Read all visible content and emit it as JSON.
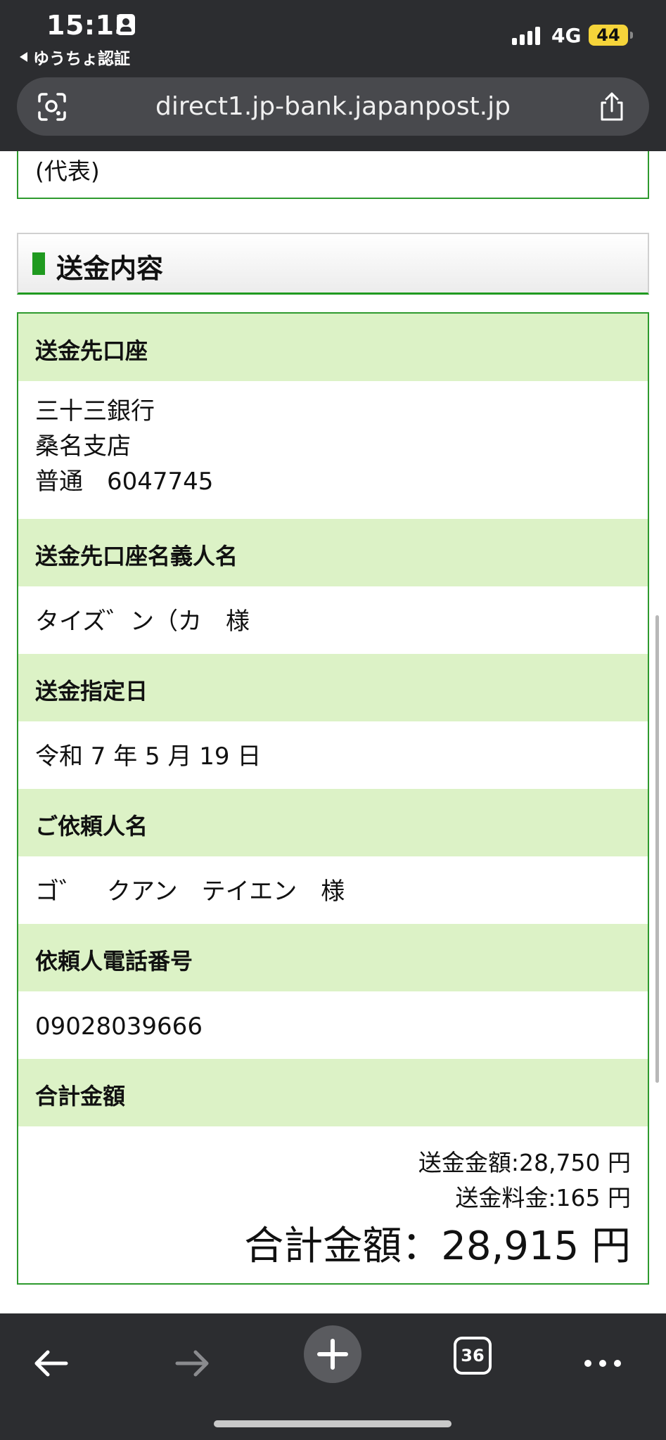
{
  "status_bar": {
    "time": "15:15",
    "back_app": "ゆうちょ認証",
    "network": "4G",
    "battery": "44"
  },
  "browser": {
    "url": "direct1.jp-bank.japanpost.jp",
    "tab_count": "36"
  },
  "page": {
    "prev_text": "(代表)",
    "section_title": "送金内容",
    "rows": [
      {
        "label": "送金先口座",
        "value_lines": [
          "三十三銀行",
          "桑名支店",
          "普通　6047745"
        ]
      },
      {
        "label": "送金先口座名義人名",
        "value_lines": [
          "タイズ゛ン（カ　様"
        ]
      },
      {
        "label": "送金指定日",
        "value_lines": [
          "令和 7 年 5 月 19 日"
        ]
      },
      {
        "label": "ご依頼人名",
        "value_lines": [
          "ゴ゛　クアン　テイエン　様"
        ]
      },
      {
        "label": "依頼人電話番号",
        "value_lines": [
          "09028039666"
        ]
      },
      {
        "label": "合計金額",
        "value_lines": []
      }
    ],
    "amounts": {
      "transfer_amount": "送金金額:28,750 円",
      "fee": "送金料金:165 円",
      "total": "合計金額：28,915 円"
    }
  },
  "colors": {
    "chrome_bg": "#2c2d30",
    "url_bar_bg": "#48494d",
    "accent_green": "#1f9a1f",
    "label_bg": "#dcf2c6"
  }
}
